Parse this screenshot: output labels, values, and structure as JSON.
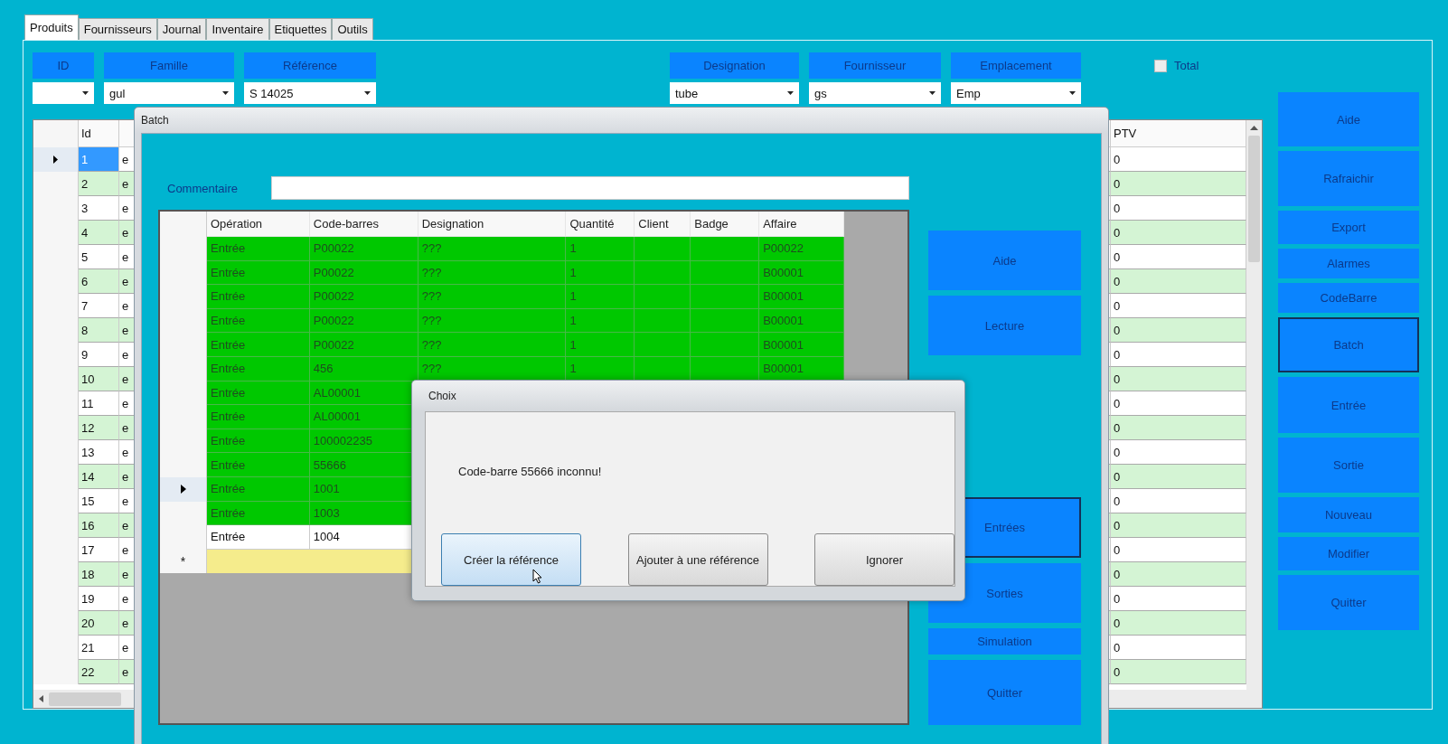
{
  "tabs": [
    {
      "label": "Produits",
      "selected": true
    },
    {
      "label": "Fournisseurs",
      "selected": false
    },
    {
      "label": "Journal",
      "selected": false
    },
    {
      "label": "Inventaire",
      "selected": false
    },
    {
      "label": "Etiquettes",
      "selected": false
    },
    {
      "label": "Outils",
      "selected": false
    }
  ],
  "filters": [
    {
      "label": "ID"
    },
    {
      "label": "Famille",
      "value": "gul"
    },
    {
      "label": "Référence",
      "value": "S 14025"
    },
    {
      "label": "Designation",
      "value": "tube"
    },
    {
      "label": "Fournisseur",
      "value": "gs"
    },
    {
      "label": "Emplacement",
      "value": "Emp"
    }
  ],
  "total": {
    "label": "Total",
    "checked": false
  },
  "products_grid": {
    "columns": {
      "id": "Id",
      "ptv": "PTV"
    },
    "rows": [
      {
        "id": "1",
        "column_3": "e",
        "ptv": "0",
        "selected": true,
        "current": true
      },
      {
        "id": "2",
        "column_3": "e",
        "ptv": "0",
        "selected": false,
        "current": false
      },
      {
        "id": "3",
        "column_3": "e",
        "ptv": "0",
        "selected": false,
        "current": false
      },
      {
        "id": "4",
        "column_3": "e",
        "ptv": "0",
        "selected": false,
        "current": false
      },
      {
        "id": "5",
        "column_3": "e",
        "ptv": "0",
        "selected": false,
        "current": false
      },
      {
        "id": "6",
        "column_3": "e",
        "ptv": "0",
        "selected": false,
        "current": false
      },
      {
        "id": "7",
        "column_3": "e",
        "ptv": "0",
        "selected": false,
        "current": false
      },
      {
        "id": "8",
        "column_3": "e",
        "ptv": "0",
        "selected": false,
        "current": false
      },
      {
        "id": "9",
        "column_3": "e",
        "ptv": "0",
        "selected": false,
        "current": false
      },
      {
        "id": "10",
        "column_3": "e",
        "ptv": "0",
        "selected": false,
        "current": false
      },
      {
        "id": "11",
        "column_3": "e",
        "ptv": "0",
        "selected": false,
        "current": false
      },
      {
        "id": "12",
        "column_3": "e",
        "ptv": "0",
        "selected": false,
        "current": false
      },
      {
        "id": "13",
        "column_3": "e",
        "ptv": "0",
        "selected": false,
        "current": false
      },
      {
        "id": "14",
        "column_3": "e",
        "ptv": "0",
        "selected": false,
        "current": false
      },
      {
        "id": "15",
        "column_3": "e",
        "ptv": "0",
        "selected": false,
        "current": false
      },
      {
        "id": "16",
        "column_3": "e",
        "ptv": "0",
        "selected": false,
        "current": false
      },
      {
        "id": "17",
        "column_3": "e",
        "ptv": "0",
        "selected": false,
        "current": false
      },
      {
        "id": "18",
        "column_3": "e",
        "ptv": "0",
        "selected": false,
        "current": false
      },
      {
        "id": "19",
        "column_3": "e",
        "ptv": "0",
        "selected": false,
        "current": false
      },
      {
        "id": "20",
        "column_3": "e",
        "ptv": "0",
        "selected": false,
        "current": false
      },
      {
        "id": "21",
        "column_3": "e",
        "ptv": "0",
        "selected": false,
        "current": false
      },
      {
        "id": "22",
        "column_3": "e",
        "ptv": "0",
        "selected": false,
        "current": false
      }
    ]
  },
  "side_buttons": [
    {
      "label": "Aide",
      "selected": false
    },
    {
      "label": "Rafraichir",
      "selected": false
    },
    {
      "label": "Export",
      "selected": false
    },
    {
      "label": "Alarmes",
      "selected": false
    },
    {
      "label": "CodeBarre",
      "selected": false
    },
    {
      "label": "Batch",
      "selected": true
    },
    {
      "label": "Entrée",
      "selected": false
    },
    {
      "label": "Sortie",
      "selected": false
    },
    {
      "label": "Nouveau",
      "selected": false
    },
    {
      "label": "Modifier",
      "selected": false
    },
    {
      "label": "Quitter",
      "selected": false
    }
  ],
  "batch_window": {
    "title": "Batch",
    "comment_label": "Commentaire",
    "columns": [
      "Opération",
      "Code-barres",
      "Designation",
      "Quantité",
      "Client",
      "Badge",
      "Affaire"
    ],
    "rows": [
      {
        "operation": "Entrée",
        "code_barres": "P00022",
        "designation": "???",
        "quantite": "1",
        "affaire": "P00022",
        "color": "#00c800",
        "current": false
      },
      {
        "operation": "Entrée",
        "code_barres": "P00022",
        "designation": "???",
        "quantite": "1",
        "affaire": "B00001",
        "color": "#00c800",
        "current": false
      },
      {
        "operation": "Entrée",
        "code_barres": "P00022",
        "designation": "???",
        "quantite": "1",
        "affaire": "B00001",
        "color": "#00c800",
        "current": false
      },
      {
        "operation": "Entrée",
        "code_barres": "P00022",
        "designation": "???",
        "quantite": "1",
        "affaire": "B00001",
        "color": "#00c800",
        "current": false
      },
      {
        "operation": "Entrée",
        "code_barres": "P00022",
        "designation": "???",
        "quantite": "1",
        "affaire": "B00001",
        "color": "#00c800",
        "current": false
      },
      {
        "operation": "Entrée",
        "code_barres": "456",
        "designation": "???",
        "quantite": "1",
        "affaire": "B00001",
        "color": "#00c800",
        "current": false
      },
      {
        "operation": "Entrée",
        "code_barres": "AL00001",
        "color": "#00c800",
        "current": false
      },
      {
        "operation": "Entrée",
        "code_barres": "AL00001",
        "color": "#00c800",
        "current": false
      },
      {
        "operation": "Entrée",
        "code_barres": "100002235",
        "color": "#00c800",
        "current": false
      },
      {
        "operation": "Entrée",
        "code_barres": "55666",
        "color": "#00c800",
        "current": false
      },
      {
        "operation": "Entrée",
        "code_barres": "1001",
        "color": "#00c800",
        "current": true
      },
      {
        "operation": "Entrée",
        "code_barres": "1003",
        "color": "#00c800",
        "current": false
      },
      {
        "operation": "Entrée",
        "code_barres": "1004",
        "color": "#ffffff",
        "current": false
      }
    ],
    "new_row": {
      "marker": "*",
      "color": "#f5ec8c"
    },
    "buttons_top": [
      {
        "label": "Aide",
        "selected": false
      },
      {
        "label": "Lecture",
        "selected": false
      }
    ],
    "buttons_bottom": [
      {
        "label": "Entrées",
        "selected": true
      },
      {
        "label": "Sorties",
        "selected": false
      },
      {
        "label": "Simulation",
        "selected": false
      },
      {
        "label": "Quitter",
        "selected": false
      }
    ]
  },
  "choice_dialog": {
    "title": "Choix",
    "message": "Code-barre 55666 inconnu!",
    "buttons": [
      {
        "label": "Créer la référence",
        "hovered": true
      },
      {
        "label": "Ajouter à une référence",
        "hovered": false
      },
      {
        "label": "Ignorer",
        "hovered": false
      }
    ]
  }
}
